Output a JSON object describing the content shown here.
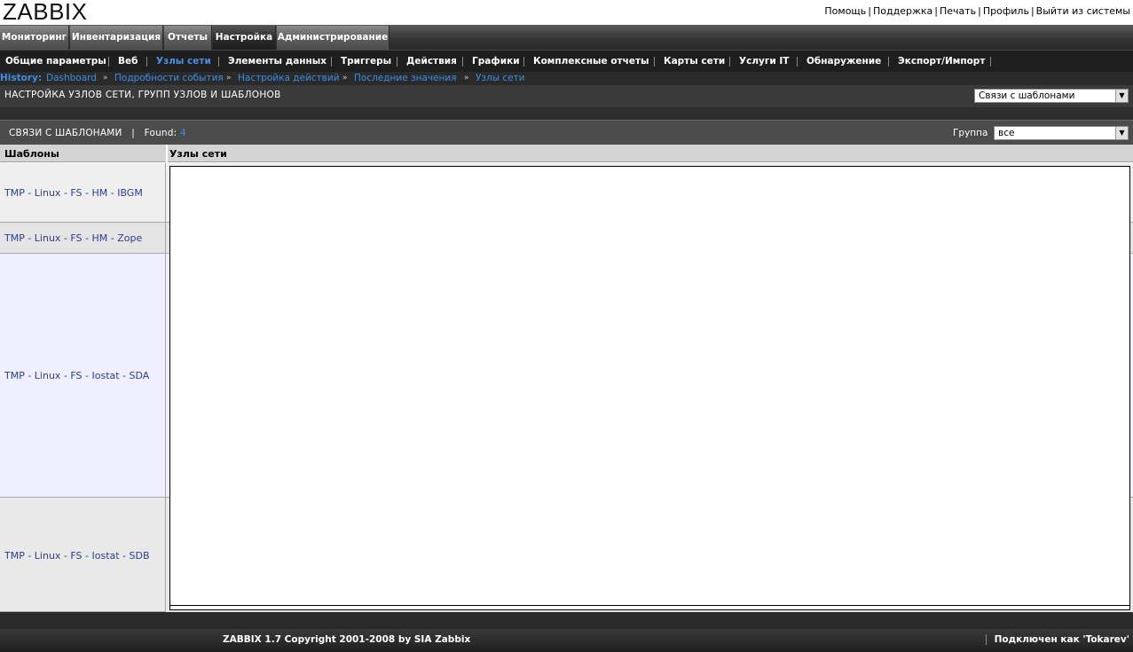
{
  "header": {
    "logo": "ZABBIX",
    "links": [
      "Помощь",
      "Поддержка",
      "Печать",
      "Профиль",
      "Выйти из системы"
    ]
  },
  "main_nav": {
    "tabs": [
      {
        "label": "Мониторинг"
      },
      {
        "label": "Инвентаризация"
      },
      {
        "label": "Отчеты"
      },
      {
        "label": "Настройка",
        "active": true
      },
      {
        "label": "Администрирование"
      }
    ]
  },
  "sub_nav": {
    "items": [
      {
        "label": "Общие параметры"
      },
      {
        "label": "Веб"
      },
      {
        "label": "Узлы сети",
        "active": true
      },
      {
        "label": "Элементы данных"
      },
      {
        "label": "Триггеры"
      },
      {
        "label": "Действия"
      },
      {
        "label": "Графики"
      },
      {
        "label": "Комплексные отчеты"
      },
      {
        "label": "Карты сети"
      },
      {
        "label": "Услуги IT"
      },
      {
        "label": "Обнаружение"
      },
      {
        "label": "Экспорт/Импорт"
      }
    ]
  },
  "history": {
    "label": "History:",
    "items": [
      "Dashboard",
      "Подробности события",
      "Настройка действий",
      "Последние значения",
      "Узлы сети"
    ]
  },
  "page": {
    "title": "НАСТРОЙКА УЗЛОВ СЕТИ, ГРУПП УЗЛОВ И ШАБЛОНОВ",
    "view_select": "Связи с шаблонами"
  },
  "list": {
    "caption": "СВЯЗИ С ШАБЛОНАМИ",
    "found_label": "Found:",
    "found_count": "4",
    "group_label": "Группа",
    "group_select": "все"
  },
  "table": {
    "headers": [
      "Шаблоны",
      "Узлы сети"
    ],
    "rows": [
      "TMP - Linux - FS - HM - IBGM",
      "TMP - Linux - FS - HM - Zope",
      "TMP - Linux - FS - Iostat - SDA",
      "TMP - Linux - FS - Iostat - SDB"
    ]
  },
  "footer": {
    "copyright": "ZABBIX 1.7 Copyright 2001-2008 by SIA Zabbix",
    "connected": "Подключен как 'Tokarev'"
  },
  "colors": {
    "accent": "#3b8de6",
    "link": "#2b3f8c",
    "nav_dark": "#1e1e1e"
  }
}
